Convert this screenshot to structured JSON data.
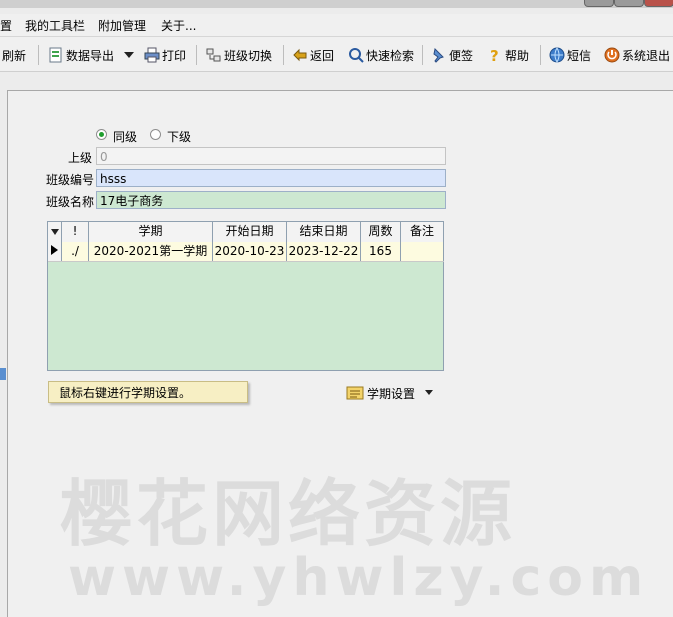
{
  "menubar": {
    "items": [
      "置",
      "我的工具栏",
      "附加管理",
      "关于..."
    ]
  },
  "toolbar": {
    "refresh": "刷新",
    "export": "数据导出",
    "print": "打印",
    "switch_class": "班级切换",
    "back": "返回",
    "quick_search": "快速检索",
    "note": "便签",
    "help": "帮助",
    "sms": "短信",
    "exit": "系统退出"
  },
  "form": {
    "level_same": "同级",
    "level_lower": "下级",
    "level_selected": "同级",
    "parent_label": "上级",
    "parent_value": "0",
    "code_label": "班级编号",
    "code_value": "hsss",
    "name_label": "班级名称",
    "name_value": "17电子商务"
  },
  "grid": {
    "columns": [
      "!",
      "学期",
      "开始日期",
      "结束日期",
      "周数",
      "备注"
    ],
    "rows": [
      {
        "flag": "./",
        "term": "2020-2021第一学期",
        "start": "2020-10-23",
        "end": "2023-12-22",
        "weeks": "165",
        "note": ""
      }
    ]
  },
  "hint": "鼠标右键进行学期设置。",
  "term_settings": "学期设置",
  "watermark": {
    "line1": "樱花网络资源",
    "line2": "www.yhwlzy.com"
  },
  "colors": {
    "grid_bg": "#cde8d1",
    "row_bg": "#fdfbe0",
    "code_field_bg": "#d9e5fb",
    "name_field_bg": "#cde8d1"
  }
}
